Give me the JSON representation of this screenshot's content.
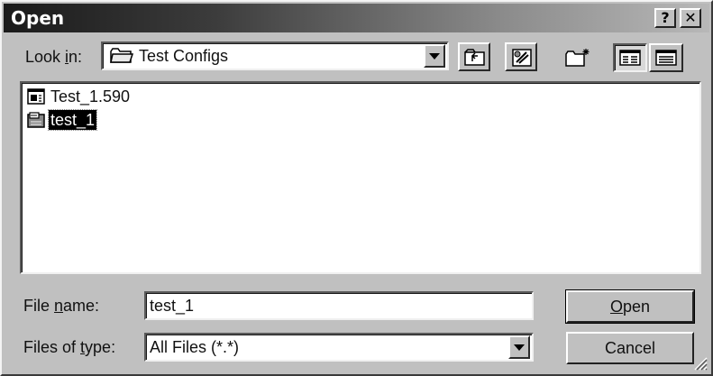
{
  "window": {
    "title": "Open",
    "help_label": "?",
    "close_label": "✕"
  },
  "look_in": {
    "label_prefix": "Look ",
    "label_underlined": "i",
    "label_suffix": "n:",
    "value": "Test Configs",
    "icon": "folder-icon"
  },
  "toolbar": {
    "buttons": [
      {
        "name": "up-one-level-button",
        "icon": "up-folder-icon"
      },
      {
        "name": "desktop-button",
        "icon": "desktop-icon"
      },
      {
        "name": "create-new-folder-button",
        "icon": "new-folder-icon"
      },
      {
        "name": "list-view-button",
        "icon": "list-view-icon",
        "pressed": true
      },
      {
        "name": "details-view-button",
        "icon": "details-view-icon"
      }
    ]
  },
  "files": [
    {
      "name": "Test_1.590",
      "icon": "document-icon",
      "selected": false
    },
    {
      "name": "test_1",
      "icon": "config-file-icon",
      "selected": true
    }
  ],
  "file_name": {
    "label_prefix": "File ",
    "label_underlined": "n",
    "label_suffix": "ame:",
    "value": "test_1"
  },
  "file_type": {
    "label_prefix": "Files of ",
    "label_underlined": "t",
    "label_suffix": "ype:",
    "value": "All Files (*.*)"
  },
  "buttons": {
    "open_underlined": "O",
    "open_rest": "pen",
    "cancel": "Cancel"
  }
}
